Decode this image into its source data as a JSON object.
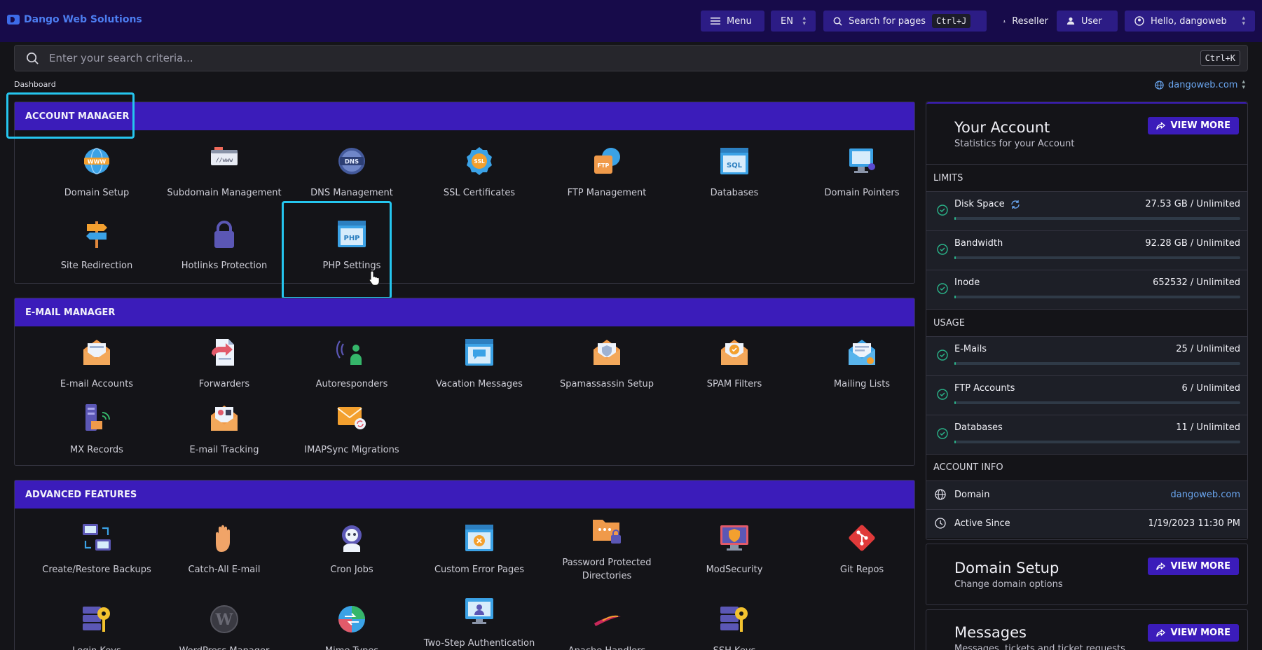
{
  "header": {
    "brand": "Dango Web Solutions",
    "menu": "Menu",
    "lang": "EN",
    "search": "Search for pages",
    "search_kbd": "Ctrl+J",
    "reseller": "Reseller",
    "user": "User",
    "hello": "Hello, dangoweb"
  },
  "search": {
    "placeholder": "Enter your search criteria...",
    "kbd": "Ctrl+K"
  },
  "breadcrumb": "Dashboard",
  "domain_selector": "dangoweb.com",
  "sections": {
    "account": {
      "title": "ACCOUNT MANAGER",
      "items": [
        "Domain Setup",
        "Subdomain Management",
        "DNS Management",
        "SSL Certificates",
        "FTP Management",
        "Databases",
        "Domain Pointers",
        "Site Redirection",
        "Hotlinks Protection",
        "PHP Settings"
      ]
    },
    "email": {
      "title": "E-MAIL MANAGER",
      "items": [
        "E-mail Accounts",
        "Forwarders",
        "Autoresponders",
        "Vacation Messages",
        "Spamassassin Setup",
        "SPAM Filters",
        "Mailing Lists",
        "MX Records",
        "E-mail Tracking",
        "IMAPSync Migrations"
      ]
    },
    "advanced": {
      "title": "ADVANCED FEATURES",
      "items": [
        "Create/Restore Backups",
        "Catch-All E-mail",
        "Cron Jobs",
        "Custom Error Pages",
        "Password Protected Directories",
        "ModSecurity",
        "Git Repos",
        "Login Keys",
        "WordPress Manager",
        "Mime Types",
        "Two-Step Authentication",
        "Apache Handlers",
        "SSH Keys"
      ]
    }
  },
  "account_panel": {
    "title": "Your Account",
    "subtitle": "Statistics for your Account",
    "view_more": "VIEW MORE",
    "limits_label": "LIMITS",
    "limits": [
      {
        "label": "Disk Space",
        "value": "27.53 GB / Unlimited",
        "usage": 0.005
      },
      {
        "label": "Bandwidth",
        "value": "92.28 GB / Unlimited",
        "usage": 0.005
      },
      {
        "label": "Inode",
        "value": "652532 / Unlimited",
        "usage": 0.005
      }
    ],
    "usage_label": "USAGE",
    "usage": [
      {
        "label": "E-Mails",
        "value": "25 / Unlimited",
        "usage": 0.005
      },
      {
        "label": "FTP Accounts",
        "value": "6 / Unlimited",
        "usage": 0.005
      },
      {
        "label": "Databases",
        "value": "11 / Unlimited",
        "usage": 0.005
      }
    ],
    "info_label": "ACCOUNT INFO",
    "domain_label": "Domain",
    "domain_value": "dangoweb.com",
    "active_label": "Active Since",
    "active_value": "1/19/2023 11:30 PM"
  },
  "domain_card": {
    "title": "Domain Setup",
    "subtitle": "Change domain options",
    "view_more": "VIEW MORE"
  },
  "messages_card": {
    "title": "Messages",
    "subtitle": "Messages, tickets and ticket requests",
    "view_more": "VIEW MORE"
  },
  "colors": {
    "accent": "#3b1cba",
    "highlight": "#25c6ef",
    "link": "#6aa6f0",
    "ok": "#2ab58a"
  }
}
